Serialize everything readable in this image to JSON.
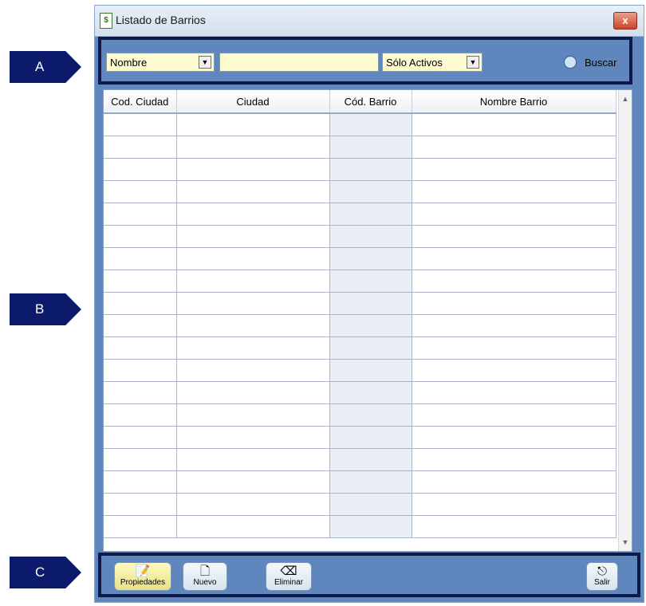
{
  "callouts": {
    "a": "A",
    "b": "B",
    "c": "C"
  },
  "window": {
    "title": "Listado de Barrios",
    "close_glyph": "x",
    "icon": "document-money-icon"
  },
  "filter": {
    "field_select": "Nombre",
    "search_value": "",
    "status_select": "Sólo Activos",
    "search_label": "Buscar",
    "search_icon": "search-icon"
  },
  "table": {
    "columns": [
      "Cod. Ciudad",
      "Ciudad",
      "Cód. Barrio",
      "Nombre Barrio"
    ],
    "empty_row_count": 19
  },
  "toolbar": {
    "properties_label": "Propiedades",
    "new_label": "Nuevo",
    "delete_label": "Eliminar",
    "exit_label": "Salir"
  },
  "colors": {
    "window_bg": "#5f86bd",
    "section_border": "#0b1a48",
    "callout_bg": "#0b1a6b",
    "input_bg": "#fffbd0",
    "highlight_column": "#e9eef7"
  }
}
